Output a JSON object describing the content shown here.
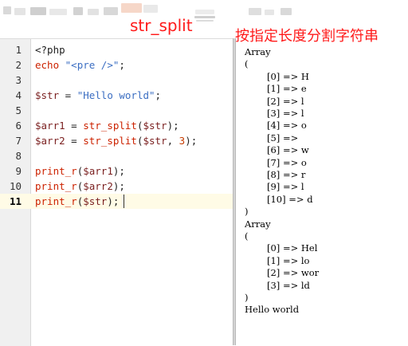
{
  "header": {
    "title": "str_split",
    "subtitle": "按指定长度分割字符串"
  },
  "editor": {
    "active_line": 11,
    "lines": [
      {
        "num": "1",
        "tokens": [
          {
            "t": "<?php",
            "c": "plain"
          }
        ]
      },
      {
        "num": "2",
        "tokens": [
          {
            "t": "echo",
            "c": "kw"
          },
          {
            "t": " ",
            "c": "plain"
          },
          {
            "t": "\"<pre />\"",
            "c": "str"
          },
          {
            "t": ";",
            "c": "plain"
          }
        ]
      },
      {
        "num": "3",
        "tokens": []
      },
      {
        "num": "4",
        "tokens": [
          {
            "t": "$str",
            "c": "var"
          },
          {
            "t": " = ",
            "c": "plain"
          },
          {
            "t": "\"Hello world\"",
            "c": "str"
          },
          {
            "t": ";",
            "c": "plain"
          }
        ]
      },
      {
        "num": "5",
        "tokens": []
      },
      {
        "num": "6",
        "tokens": [
          {
            "t": "$arr1",
            "c": "var"
          },
          {
            "t": " = ",
            "c": "plain"
          },
          {
            "t": "str_split",
            "c": "kw"
          },
          {
            "t": "(",
            "c": "plain"
          },
          {
            "t": "$str",
            "c": "var"
          },
          {
            "t": ");",
            "c": "plain"
          }
        ]
      },
      {
        "num": "7",
        "tokens": [
          {
            "t": "$arr2",
            "c": "var"
          },
          {
            "t": " = ",
            "c": "plain"
          },
          {
            "t": "str_split",
            "c": "kw"
          },
          {
            "t": "(",
            "c": "plain"
          },
          {
            "t": "$str",
            "c": "var"
          },
          {
            "t": ", ",
            "c": "plain"
          },
          {
            "t": "3",
            "c": "num"
          },
          {
            "t": ");",
            "c": "plain"
          }
        ]
      },
      {
        "num": "8",
        "tokens": []
      },
      {
        "num": "9",
        "tokens": [
          {
            "t": "print_r",
            "c": "kw"
          },
          {
            "t": "(",
            "c": "plain"
          },
          {
            "t": "$arr1",
            "c": "var"
          },
          {
            "t": ");",
            "c": "plain"
          }
        ]
      },
      {
        "num": "10",
        "tokens": [
          {
            "t": "print_r",
            "c": "kw"
          },
          {
            "t": "(",
            "c": "plain"
          },
          {
            "t": "$arr2",
            "c": "var"
          },
          {
            "t": ");",
            "c": "plain"
          }
        ]
      },
      {
        "num": "11",
        "tokens": [
          {
            "t": "print_r",
            "c": "kw"
          },
          {
            "t": "(",
            "c": "plain"
          },
          {
            "t": "$str",
            "c": "var"
          },
          {
            "t": ");",
            "c": "plain"
          }
        ]
      }
    ]
  },
  "output": {
    "lines": [
      {
        "text": "Array",
        "indent": 0
      },
      {
        "text": "(",
        "indent": 0
      },
      {
        "text": "[0] => H",
        "indent": 1
      },
      {
        "text": "[1] => e",
        "indent": 1
      },
      {
        "text": "[2] => l",
        "indent": 1
      },
      {
        "text": "[3] => l",
        "indent": 1
      },
      {
        "text": "[4] => o",
        "indent": 1
      },
      {
        "text": "[5] =>",
        "indent": 1
      },
      {
        "text": "[6] => w",
        "indent": 1
      },
      {
        "text": "[7] => o",
        "indent": 1
      },
      {
        "text": "[8] => r",
        "indent": 1
      },
      {
        "text": "[9] => l",
        "indent": 1
      },
      {
        "text": "[10] => d",
        "indent": 1
      },
      {
        "text": ")",
        "indent": 0
      },
      {
        "text": "Array",
        "indent": 0
      },
      {
        "text": "(",
        "indent": 0
      },
      {
        "text": "[0] => Hel",
        "indent": 1
      },
      {
        "text": "[1] => lo",
        "indent": 1
      },
      {
        "text": "[2] => wor",
        "indent": 1
      },
      {
        "text": "[3] => ld",
        "indent": 1
      },
      {
        "text": ")",
        "indent": 0
      },
      {
        "text": "Hello world",
        "indent": 0
      }
    ]
  },
  "colors": {
    "title_red": "#ff1a1a",
    "keyword": "#cc2200",
    "string": "#3b6ec2",
    "variable": "#7a1f1f",
    "number": "#c63c00",
    "active_line_bg": "#fffbe6"
  }
}
